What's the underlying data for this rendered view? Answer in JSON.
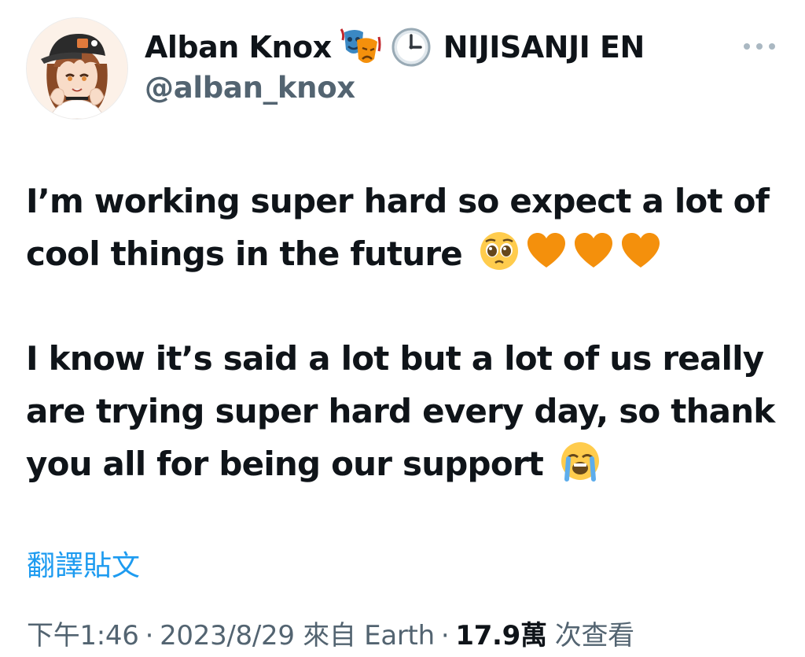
{
  "user": {
    "display_name": "Alban Knox",
    "org_name": "NIJISANJI EN",
    "handle": "@alban_knox",
    "name_emojis": [
      "performing-arts-emoji",
      "clock-emoji"
    ]
  },
  "tweet": {
    "paragraphs": [
      {
        "text": "I’m working super hard so expect a lot of cool things in the future",
        "emojis": [
          "pleading-face-emoji",
          "orange-heart-emoji",
          "orange-heart-emoji",
          "orange-heart-emoji"
        ]
      },
      {
        "text": "I know it’s said a lot but a lot of us really are trying super hard every day, so thank you all for being our support",
        "emojis": [
          "loudly-crying-face-emoji"
        ]
      }
    ],
    "translate_label": "翻譯貼文"
  },
  "meta": {
    "time": "下午1:46",
    "separator": "·",
    "date": "2023/8/29",
    "source": "來自 Earth",
    "views_count": "17.9",
    "views_unit": "萬",
    "views_label": "次查看"
  },
  "colors": {
    "accent": "#1d9bf0",
    "secondary_text": "#536471",
    "primary_text": "#0f1419",
    "heart": "#f4900c"
  }
}
